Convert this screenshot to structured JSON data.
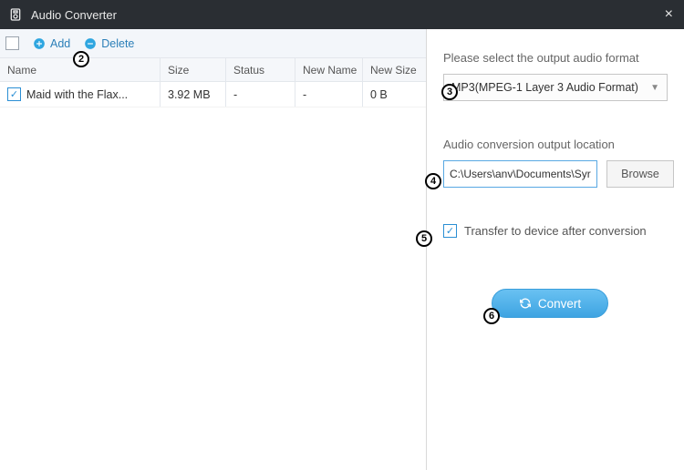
{
  "titlebar": {
    "title": "Audio Converter"
  },
  "toolbar": {
    "add_label": "Add",
    "delete_label": "Delete"
  },
  "columns": {
    "name": "Name",
    "size": "Size",
    "status": "Status",
    "newname": "New Name",
    "newsize": "New Size"
  },
  "rows": [
    {
      "checked": true,
      "name": "Maid with the Flax...",
      "size": "3.92 MB",
      "status": "-",
      "newname": "-",
      "newsize": "0 B"
    }
  ],
  "right": {
    "format_label": "Please select the output audio format",
    "format_value": "MP3(MPEG-1 Layer 3 Audio Format)",
    "location_label": "Audio conversion output location",
    "location_value": "C:\\Users\\anv\\Documents\\Syr",
    "browse_label": "Browse",
    "transfer_label": "Transfer to device after conversion",
    "transfer_checked": true,
    "convert_label": "Convert"
  },
  "badges": {
    "b2": "2",
    "b3": "3",
    "b4": "4",
    "b5": "5",
    "b6": "6"
  }
}
